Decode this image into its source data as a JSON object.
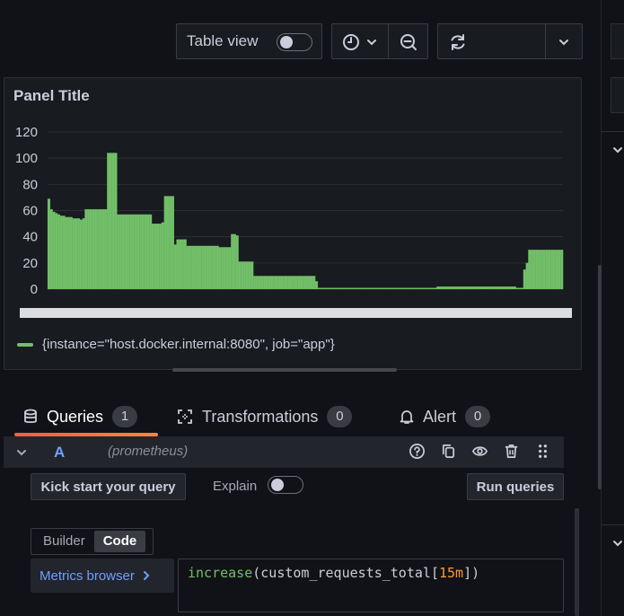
{
  "toolbar": {
    "table_view_label": "Table view",
    "table_view_on": false
  },
  "panel": {
    "title": "Panel Title",
    "legend_label": "{instance=\"host.docker.internal:8080\", job=\"app\"}",
    "series_color": "#73bf69"
  },
  "chart_data": {
    "type": "bar",
    "title": "Panel Title",
    "ylim": [
      0,
      120
    ],
    "y_ticks": [
      "0",
      "20",
      "40",
      "60",
      "80",
      "100",
      "120"
    ],
    "grid": true,
    "legend_placement": "bottom-left",
    "series": [
      {
        "name": "{instance=\"host.docker.internal:8080\", job=\"app\"}",
        "color": "#73bf69",
        "values": [
          69,
          61,
          59,
          58,
          57,
          56,
          56,
          55,
          55,
          55,
          54,
          54,
          54,
          53,
          54,
          61,
          61,
          61,
          61,
          61,
          61,
          61,
          61,
          61,
          104,
          104,
          104,
          104,
          57,
          57,
          57,
          57,
          57,
          57,
          57,
          57,
          57,
          57,
          57,
          57,
          57,
          57,
          50,
          50,
          50,
          50,
          51,
          71,
          71,
          71,
          71,
          34,
          38,
          38,
          38,
          38,
          33,
          33,
          33,
          33,
          33,
          33,
          33,
          33,
          33,
          33,
          33,
          33,
          33,
          32,
          32,
          32,
          32,
          32,
          42,
          42,
          41,
          21,
          21,
          21,
          21,
          21,
          21,
          10,
          10,
          10,
          10,
          10,
          10,
          10,
          10,
          10,
          10,
          10,
          10,
          10,
          10,
          10,
          10,
          10,
          10,
          10,
          10,
          10,
          10,
          10,
          10,
          10,
          6,
          1,
          1,
          1,
          1,
          1,
          1,
          1,
          1,
          1,
          1,
          1,
          1,
          1,
          1,
          1,
          1,
          1,
          1,
          1,
          1,
          1,
          1,
          1,
          1,
          1,
          1,
          1,
          1,
          1,
          1,
          1,
          1,
          1,
          1,
          1,
          1,
          1,
          1,
          1,
          1,
          1,
          1,
          1,
          1,
          1,
          1,
          1,
          1,
          2,
          2,
          2,
          2,
          2,
          2,
          2,
          2,
          2,
          2,
          2,
          2,
          2,
          2,
          2,
          2,
          2,
          2,
          2,
          2,
          2,
          2,
          2,
          2,
          2,
          2,
          2,
          2,
          2,
          2,
          2,
          2,
          1,
          1,
          1,
          15,
          20,
          30,
          30,
          30,
          30,
          30,
          30,
          30,
          30,
          30,
          30,
          30,
          30,
          30,
          30
        ]
      }
    ]
  },
  "tabs": [
    {
      "label": "Queries",
      "count": "1",
      "active": true
    },
    {
      "label": "Transformations",
      "count": "0",
      "active": false
    },
    {
      "label": "Alert",
      "count": "0",
      "active": false
    }
  ],
  "query": {
    "ref_id": "A",
    "datasource": "(prometheus)",
    "kick_start_label": "Kick start your query",
    "explain_label": "Explain",
    "run_label": "Run queries",
    "modes": [
      "Builder",
      "Code"
    ],
    "active_mode": "Code",
    "metrics_browser_label": "Metrics browser",
    "expression": {
      "fn": "increase",
      "open": "(",
      "metric": "custom_requests_total",
      "range_open": "[",
      "range": "15m",
      "range_close": "])"
    }
  },
  "icons": {
    "time": "clock-icon",
    "zoom_out": "zoom-out-icon",
    "refresh": "refresh-icon",
    "dropdown": "chevron-down-icon",
    "database": "database-icon",
    "transform": "transform-icon",
    "alert": "bell-icon",
    "help": "help-icon",
    "duplicate": "copy-icon",
    "toggle_visibility": "eye-icon",
    "delete": "trash-icon",
    "drag": "drag-handle-icon"
  }
}
